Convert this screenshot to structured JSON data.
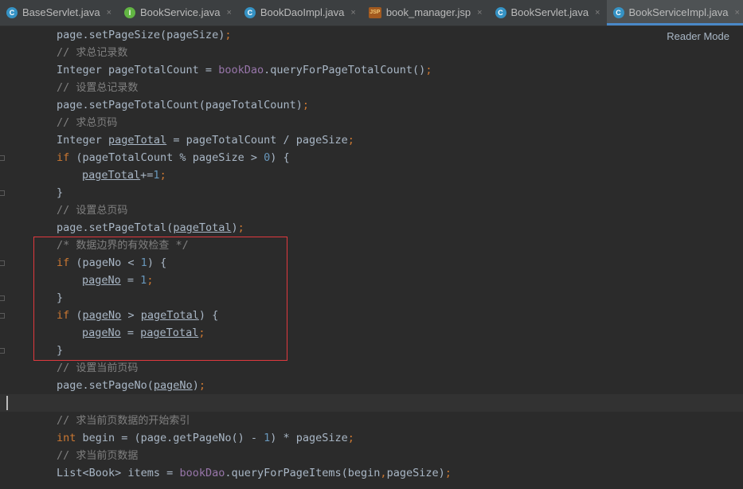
{
  "tabs": [
    {
      "label": "BaseServlet.java",
      "icon": "class-icon",
      "active": false
    },
    {
      "label": "BookService.java",
      "icon": "interface-icon",
      "active": false
    },
    {
      "label": "BookDaoImpl.java",
      "icon": "class-icon",
      "active": false
    },
    {
      "label": "book_manager.jsp",
      "icon": "jsp-icon",
      "active": false
    },
    {
      "label": "BookServlet.java",
      "icon": "class-icon",
      "active": false
    },
    {
      "label": "BookServiceImpl.java",
      "icon": "class-icon",
      "active": true
    }
  ],
  "tab_close_glyph": "×",
  "icon_letters": {
    "class": "C",
    "interface": "I",
    "jsp": "JSP"
  },
  "editor": {
    "reader_mode": "Reader Mode",
    "code": {
      "line1": {
        "a": "page.setPageSize(pageSize)",
        "b": ";"
      },
      "line2": {
        "slashes": "// ",
        "text": "求总记录数"
      },
      "line3": {
        "a": "Integer pageTotalCount = ",
        "b": "bookDao",
        "c": ".queryForPageTotalCount()",
        "d": ";"
      },
      "line4": {
        "slashes": "// ",
        "text": "设置总记录数"
      },
      "line5": {
        "a": "page.setPageTotalCount(pageTotalCount)",
        "b": ";"
      },
      "line6": {
        "slashes": "// ",
        "text": "求总页码"
      },
      "line7": {
        "a": "Integer ",
        "b": "pageTotal",
        "c": " = pageTotalCount / pageSize",
        "d": ";"
      },
      "line8": {
        "kw": "if",
        "a": " (pageTotalCount % pageSize > ",
        "num": "0",
        "b": ") {"
      },
      "line9": {
        "a": "pageTotal",
        "b": "+=",
        "num": "1",
        "c": ";"
      },
      "line10": {
        "a": "}"
      },
      "line11": {
        "slashes": "// ",
        "text": "设置总页码"
      },
      "line12": {
        "a": "page.setPageTotal(",
        "b": "pageTotal",
        "c": ")",
        "d": ";"
      },
      "line13": {
        "open": "/* ",
        "text": "数据边界的有效检查",
        "close": " */"
      },
      "line14": {
        "kw": "if",
        "a": " (pageNo < ",
        "num": "1",
        "b": ") {"
      },
      "line15": {
        "a": "pageNo",
        "b": " = ",
        "num": "1",
        "c": ";"
      },
      "line16": {
        "a": "}"
      },
      "line17": {
        "kw": "if",
        "a": " (",
        "b": "pageNo",
        "c": " > ",
        "d": "pageTotal",
        "e": ") {"
      },
      "line18": {
        "a": "pageNo",
        "b": " = ",
        "c": "pageTotal",
        "d": ";"
      },
      "line19": {
        "a": "}"
      },
      "line20": {
        "slashes": "// ",
        "text": "设置当前页码"
      },
      "line21": {
        "a": "page.setPageNo(",
        "b": "pageNo",
        "c": ")",
        "d": ";"
      },
      "line23": {
        "slashes": "// ",
        "text": "求当前页数据的开始索引"
      },
      "line24": {
        "kw": "int",
        "a": " begin = (page.getPageNo() - ",
        "num": "1",
        "b": ") * pageSize",
        "c": ";"
      },
      "line25": {
        "slashes": "// ",
        "text": "求当前页数据"
      },
      "line26": {
        "a": "List<Book> items = ",
        "b": "bookDao",
        "c": ".queryForPageItems(begin",
        "d": ",",
        "e": "pageSize)",
        "f": ";"
      }
    }
  },
  "colors": {
    "background": "#2b2b2b",
    "keyword": "#cc7832",
    "number": "#6897bb",
    "comment": "#808080",
    "field": "#9876aa",
    "text": "#a9b7c6",
    "highlight_box": "#e0393e",
    "active_tab_underline": "#4a88c7"
  }
}
